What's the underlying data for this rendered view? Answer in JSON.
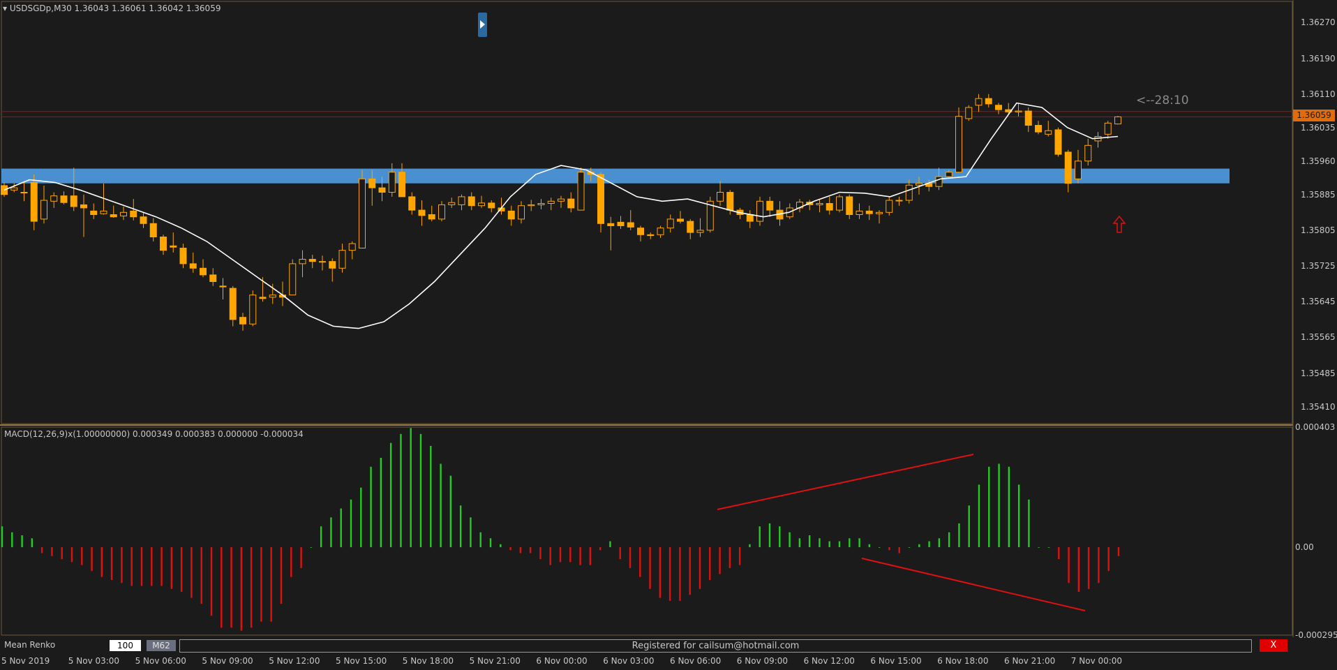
{
  "header": {
    "symbol_line": "USDSGDp,M30  1.36043 1.36061 1.36042 1.36059",
    "menu_icon": "triangle-down-icon"
  },
  "macd": {
    "label": "MACD(12,26,9)x(1.00000000) 0.000349 0.000383 0.000000 -0.000034",
    "ticks": [
      "0.000403",
      "0.00",
      "-0.000295"
    ]
  },
  "price_axis": {
    "ticks": [
      "1.36270",
      "1.36190",
      "1.36110",
      "1.36035",
      "1.35960",
      "1.35885",
      "1.35805",
      "1.35725",
      "1.35645",
      "1.35565",
      "1.35485",
      "1.35410"
    ],
    "current_price": "1.36059"
  },
  "countdown": "<--28:10",
  "time_axis": {
    "labels": [
      "5 Nov 2019",
      "5 Nov 03:00",
      "5 Nov 06:00",
      "5 Nov 09:00",
      "5 Nov 12:00",
      "5 Nov 15:00",
      "5 Nov 18:00",
      "5 Nov 21:00",
      "6 Nov 00:00",
      "6 Nov 03:00",
      "6 Nov 06:00",
      "6 Nov 09:00",
      "6 Nov 12:00",
      "6 Nov 15:00",
      "6 Nov 18:00",
      "6 Nov 21:00",
      "7 Nov 00:00"
    ]
  },
  "renko_panel": {
    "title": "Mean Renko",
    "value": "100",
    "timeframe": "M62",
    "registration": "Registered for cailsum@hotmail.com",
    "close_label": "X"
  },
  "colors": {
    "background": "#1b1b1b",
    "bull_candle": "#1b1b1b",
    "bear_candle": "#ffa500",
    "ma_line": "#ffffff",
    "zone": "#4a90d0",
    "macd_up": "#22cc22",
    "macd_down": "#dd1111",
    "price_line": "#cc0000",
    "badge": "#e36c09"
  },
  "chart_data": [
    {
      "type": "candlestick",
      "symbol": "USDSGDp",
      "timeframe": "M30",
      "ylim": [
        1.35375,
        1.36305
      ],
      "ohlc": [
        [
          1.35905,
          1.35912,
          1.3588,
          1.35885
        ],
        [
          1.35895,
          1.3591,
          1.3589,
          1.359
        ],
        [
          1.3589,
          1.35915,
          1.3587,
          1.3589
        ],
        [
          1.35912,
          1.3593,
          1.35805,
          1.35825
        ],
        [
          1.3583,
          1.35905,
          1.3582,
          1.35872
        ],
        [
          1.3587,
          1.3589,
          1.35855,
          1.35882
        ],
        [
          1.35882,
          1.35892,
          1.35863,
          1.35867
        ],
        [
          1.35882,
          1.35945,
          1.35848,
          1.35858
        ],
        [
          1.35862,
          1.35885,
          1.3579,
          1.35855
        ],
        [
          1.35848,
          1.35865,
          1.3583,
          1.3584
        ],
        [
          1.35842,
          1.3591,
          1.3584,
          1.35848
        ],
        [
          1.3584,
          1.3586,
          1.35833,
          1.35835
        ],
        [
          1.35837,
          1.35858,
          1.35828,
          1.35845
        ],
        [
          1.35848,
          1.35875,
          1.35827,
          1.35835
        ],
        [
          1.35835,
          1.35845,
          1.3581,
          1.3582
        ],
        [
          1.3582,
          1.35832,
          1.3578,
          1.3579
        ],
        [
          1.3579,
          1.35795,
          1.3575,
          1.3576
        ],
        [
          1.3577,
          1.358,
          1.35755,
          1.35767
        ],
        [
          1.35765,
          1.35775,
          1.3572,
          1.3573
        ],
        [
          1.3573,
          1.35755,
          1.3571,
          1.3572
        ],
        [
          1.3572,
          1.3574,
          1.357,
          1.35705
        ],
        [
          1.35705,
          1.3572,
          1.3568,
          1.3569
        ],
        [
          1.3568,
          1.35698,
          1.3565,
          1.35678
        ],
        [
          1.35675,
          1.3568,
          1.3559,
          1.35605
        ],
        [
          1.3561,
          1.3562,
          1.3558,
          1.35595
        ],
        [
          1.35595,
          1.3567,
          1.3559,
          1.3566
        ],
        [
          1.35655,
          1.357,
          1.35645,
          1.35652
        ],
        [
          1.35655,
          1.35685,
          1.3564,
          1.3566
        ],
        [
          1.3566,
          1.3569,
          1.35635,
          1.35655
        ],
        [
          1.3566,
          1.3574,
          1.3566,
          1.3573
        ],
        [
          1.3573,
          1.3576,
          1.357,
          1.3574
        ],
        [
          1.3574,
          1.3575,
          1.3572,
          1.35735
        ],
        [
          1.35735,
          1.35748,
          1.35715,
          1.35735
        ],
        [
          1.35735,
          1.35742,
          1.3569,
          1.3572
        ],
        [
          1.3572,
          1.35775,
          1.3571,
          1.3576
        ],
        [
          1.3576,
          1.3578,
          1.3574,
          1.35775
        ],
        [
          1.35765,
          1.3594,
          1.35765,
          1.3592
        ],
        [
          1.3592,
          1.3594,
          1.3586,
          1.359
        ],
        [
          1.359,
          1.35925,
          1.3587,
          1.3589
        ],
        [
          1.3589,
          1.35955,
          1.3588,
          1.35935
        ],
        [
          1.35935,
          1.35955,
          1.3589,
          1.3588
        ],
        [
          1.3588,
          1.3589,
          1.3584,
          1.3585
        ],
        [
          1.3585,
          1.35872,
          1.35815,
          1.35838
        ],
        [
          1.3584,
          1.3586,
          1.35825,
          1.3583
        ],
        [
          1.3583,
          1.3587,
          1.35825,
          1.35862
        ],
        [
          1.35862,
          1.35878,
          1.35855,
          1.35867
        ],
        [
          1.35862,
          1.35885,
          1.3585,
          1.3588
        ],
        [
          1.3588,
          1.3589,
          1.3585,
          1.3586
        ],
        [
          1.3586,
          1.35882,
          1.35855,
          1.35866
        ],
        [
          1.35866,
          1.35872,
          1.35845,
          1.35855
        ],
        [
          1.35855,
          1.35878,
          1.3584,
          1.35848
        ],
        [
          1.35848,
          1.3586,
          1.35815,
          1.3583
        ],
        [
          1.3583,
          1.3587,
          1.3582,
          1.3586
        ],
        [
          1.3586,
          1.35873,
          1.35848,
          1.35862
        ],
        [
          1.35862,
          1.35875,
          1.35852,
          1.35865
        ],
        [
          1.35865,
          1.35878,
          1.3585,
          1.3587
        ],
        [
          1.3587,
          1.35882,
          1.35855,
          1.35875
        ],
        [
          1.35875,
          1.3589,
          1.35845,
          1.35855
        ],
        [
          1.3585,
          1.35945,
          1.3585,
          1.35935
        ],
        [
          1.35935,
          1.35945,
          1.35915,
          1.3593
        ],
        [
          1.3593,
          1.35935,
          1.358,
          1.3582
        ],
        [
          1.3582,
          1.35835,
          1.3576,
          1.35815
        ],
        [
          1.35823,
          1.35837,
          1.35808,
          1.35815
        ],
        [
          1.35822,
          1.3585,
          1.35805,
          1.35812
        ],
        [
          1.3581,
          1.35815,
          1.3578,
          1.35795
        ],
        [
          1.35795,
          1.358,
          1.35785,
          1.35793
        ],
        [
          1.35795,
          1.35815,
          1.35788,
          1.3581
        ],
        [
          1.3581,
          1.3584,
          1.358,
          1.3583
        ],
        [
          1.3583,
          1.35848,
          1.3582,
          1.35825
        ],
        [
          1.35825,
          1.3583,
          1.35785,
          1.358
        ],
        [
          1.358,
          1.35832,
          1.3579,
          1.35805
        ],
        [
          1.35805,
          1.3588,
          1.358,
          1.3587
        ],
        [
          1.3587,
          1.35915,
          1.3586,
          1.3589
        ],
        [
          1.3589,
          1.35895,
          1.3584,
          1.3585
        ],
        [
          1.3585,
          1.35855,
          1.3583,
          1.3584
        ],
        [
          1.3584,
          1.3585,
          1.3581,
          1.35825
        ],
        [
          1.35825,
          1.3588,
          1.35815,
          1.3587
        ],
        [
          1.3587,
          1.3588,
          1.35835,
          1.3585
        ],
        [
          1.3585,
          1.3587,
          1.35815,
          1.3583
        ],
        [
          1.35835,
          1.35865,
          1.3583,
          1.35855
        ],
        [
          1.35855,
          1.35875,
          1.35845,
          1.35868
        ],
        [
          1.35868,
          1.35873,
          1.3585,
          1.35862
        ],
        [
          1.35862,
          1.35875,
          1.35845,
          1.35865
        ],
        [
          1.35865,
          1.3588,
          1.3584,
          1.3585
        ],
        [
          1.3585,
          1.35885,
          1.35845,
          1.3588
        ],
        [
          1.3588,
          1.35885,
          1.3583,
          1.3584
        ],
        [
          1.3584,
          1.35865,
          1.3583,
          1.35848
        ],
        [
          1.35848,
          1.3586,
          1.35828,
          1.35842
        ],
        [
          1.35842,
          1.3585,
          1.3582,
          1.35845
        ],
        [
          1.35845,
          1.3588,
          1.35838,
          1.35872
        ],
        [
          1.35872,
          1.3588,
          1.3586,
          1.35872
        ],
        [
          1.35872,
          1.35918,
          1.35865,
          1.35906
        ],
        [
          1.35906,
          1.35925,
          1.35885,
          1.3591
        ],
        [
          1.3591,
          1.35918,
          1.35892,
          1.35903
        ],
        [
          1.35903,
          1.35945,
          1.35895,
          1.35925
        ],
        [
          1.35925,
          1.3594,
          1.3592,
          1.35935
        ],
        [
          1.35935,
          1.3608,
          1.35935,
          1.3606
        ],
        [
          1.36055,
          1.36085,
          1.3605,
          1.3608
        ],
        [
          1.36085,
          1.3611,
          1.3607,
          1.361
        ],
        [
          1.361,
          1.3611,
          1.3608,
          1.36088
        ],
        [
          1.36085,
          1.3609,
          1.36065,
          1.36075
        ],
        [
          1.36075,
          1.3609,
          1.36065,
          1.3607
        ],
        [
          1.3607,
          1.36088,
          1.3606,
          1.36072
        ],
        [
          1.36072,
          1.3608,
          1.36025,
          1.3604
        ],
        [
          1.3604,
          1.3605,
          1.3602,
          1.36025
        ],
        [
          1.3602,
          1.3605,
          1.36015,
          1.36028
        ],
        [
          1.3603,
          1.36035,
          1.3597,
          1.35975
        ],
        [
          1.3598,
          1.35985,
          1.3589,
          1.3591
        ],
        [
          1.3592,
          1.35985,
          1.3591,
          1.3596
        ],
        [
          1.3596,
          1.3601,
          1.3595,
          1.35995
        ],
        [
          1.36005,
          1.36025,
          1.3599,
          1.36015
        ],
        [
          1.3602,
          1.3605,
          1.3601,
          1.36045
        ],
        [
          1.36043,
          1.36061,
          1.36042,
          1.36059
        ]
      ],
      "ma_line": [
        1.35895,
        1.35918,
        1.35912,
        1.35895,
        1.35875,
        1.35855,
        1.35835,
        1.3581,
        1.3578,
        1.3574,
        1.357,
        1.3566,
        1.35615,
        1.3559,
        1.35585,
        1.356,
        1.3564,
        1.3569,
        1.3575,
        1.3581,
        1.3588,
        1.3593,
        1.3595,
        1.3594,
        1.3591,
        1.3588,
        1.3587,
        1.35875,
        1.3586,
        1.35845,
        1.35835,
        1.35845,
        1.3587,
        1.3589,
        1.35888,
        1.3588,
        1.359,
        1.3592,
        1.35925,
        1.3601,
        1.3609,
        1.3608,
        1.36035,
        1.3601,
        1.36015
      ],
      "zone": [
        1.3591,
        1.35943
      ],
      "current_price": 1.36059
    },
    {
      "type": "bar",
      "title": "MACD(12,26,9)x(1.00000000)",
      "ylim": [
        -0.000295,
        0.000403
      ],
      "values": [
        7e-05,
        5e-05,
        4e-05,
        3e-05,
        -2e-05,
        -3e-05,
        -4e-05,
        -5e-05,
        -6e-05,
        -8e-05,
        -0.0001,
        -0.00011,
        -0.00012,
        -0.00013,
        -0.00013,
        -0.00013,
        -0.00013,
        -0.00014,
        -0.00015,
        -0.00017,
        -0.00019,
        -0.00023,
        -0.00027,
        -0.00027,
        -0.00028,
        -0.00027,
        -0.00025,
        -0.00025,
        -0.00019,
        -0.0001,
        -7e-05,
        0.0,
        7e-05,
        0.0001,
        0.00013,
        0.00016,
        0.0002,
        0.00027,
        0.0003,
        0.00035,
        0.00038,
        0.0004,
        0.00038,
        0.00034,
        0.00028,
        0.00024,
        0.00014,
        0.0001,
        5e-05,
        3e-05,
        1e-05,
        -1e-05,
        -2e-05,
        -2e-05,
        -4e-05,
        -6e-05,
        -5e-05,
        -5e-05,
        -6e-05,
        -6e-05,
        -1e-05,
        2e-05,
        -4e-05,
        -7e-05,
        -0.0001,
        -0.00014,
        -0.00017,
        -0.00018,
        -0.00018,
        -0.00016,
        -0.00014,
        -0.00011,
        -9e-05,
        -7e-05,
        -6e-05,
        1e-05,
        7e-05,
        8e-05,
        7e-05,
        5e-05,
        3e-05,
        4e-05,
        3e-05,
        2e-05,
        2e-05,
        3e-05,
        3e-05,
        1e-05,
        0.0,
        -1e-05,
        -2e-05,
        0.0,
        1e-05,
        2e-05,
        3e-05,
        5e-05,
        8e-05,
        0.00014,
        0.00021,
        0.00027,
        0.00028,
        0.00027,
        0.00021,
        0.00016,
        0.0,
        0.0,
        -4e-05,
        -0.00012,
        -0.00015,
        -0.00014,
        -0.00012,
        -8e-05,
        -3e-05
      ]
    }
  ]
}
